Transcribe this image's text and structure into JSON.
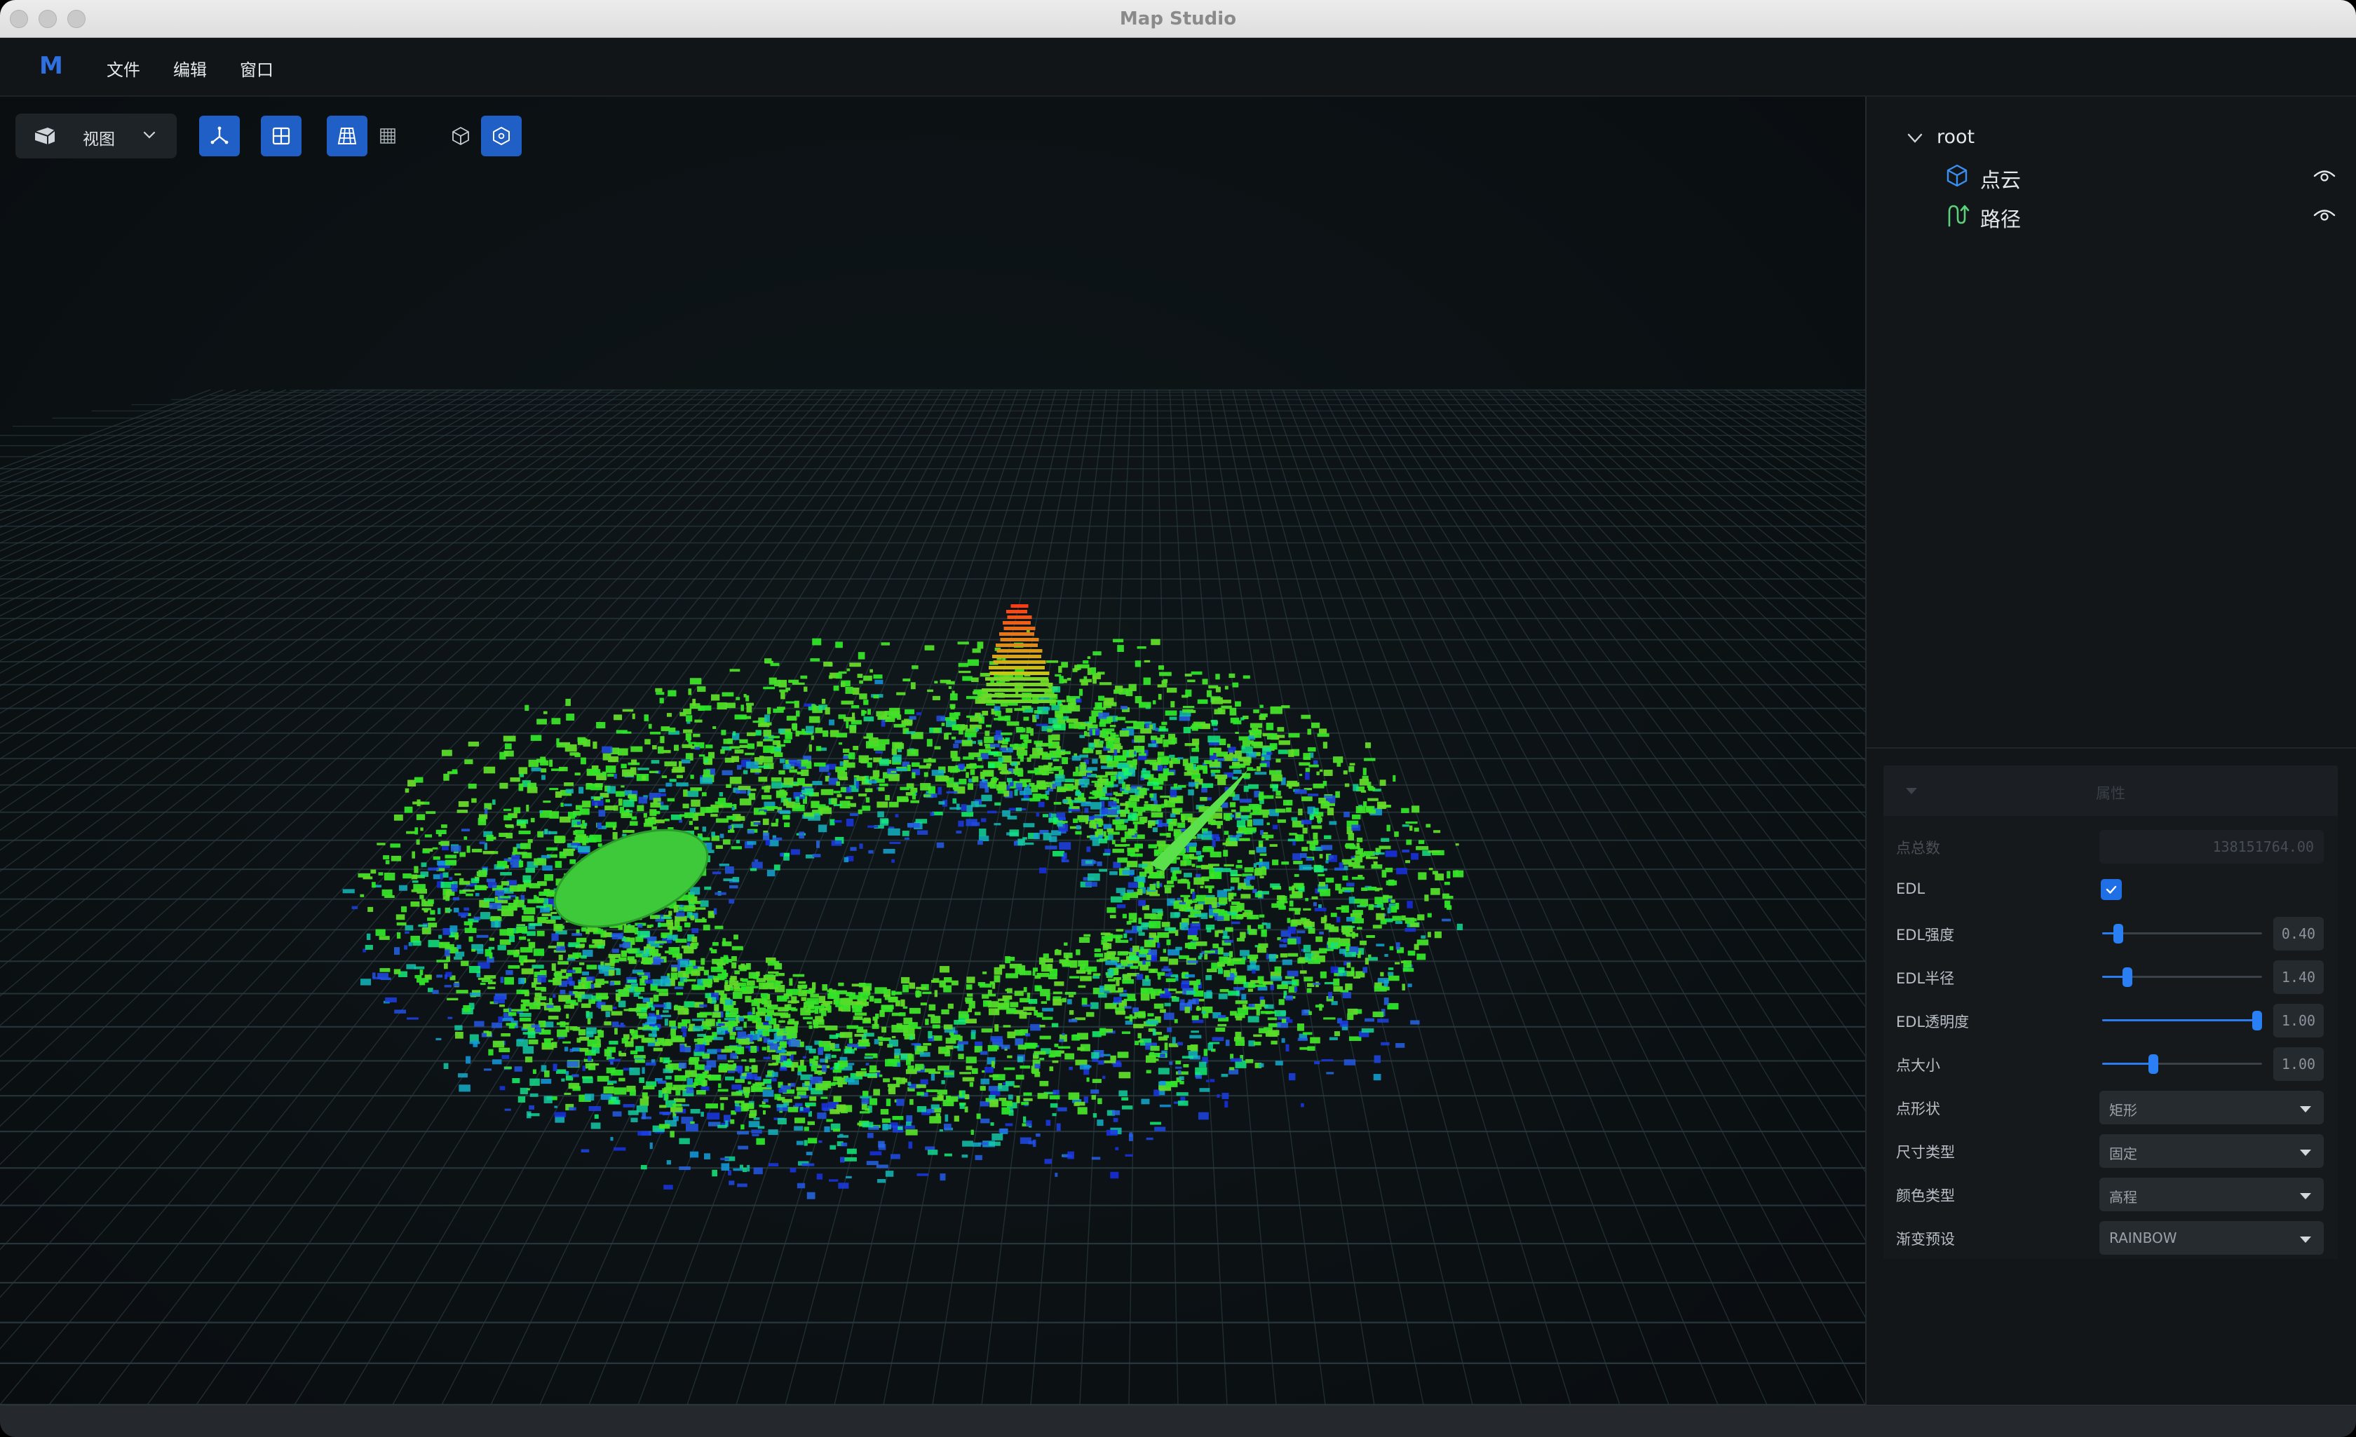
{
  "window": {
    "title": "Map Studio"
  },
  "menubar": {
    "logo": "M",
    "items": [
      {
        "label": "文件"
      },
      {
        "label": "编辑"
      },
      {
        "label": "窗口"
      }
    ]
  },
  "toolbar": {
    "view_label": "视图",
    "buttons": [
      {
        "icon": "axes-icon",
        "active": true
      },
      {
        "icon": "quad-view-icon",
        "active": true
      },
      {
        "icon": "grid-perspective-icon",
        "active": true
      },
      {
        "icon": "grid-flat-icon",
        "active": false
      },
      {
        "icon": "cube-icon",
        "active": false
      },
      {
        "icon": "hexagon-icon",
        "active": true
      }
    ]
  },
  "tree": {
    "root_label": "root",
    "items": [
      {
        "label": "点云",
        "icon": "cube-icon",
        "visible": true
      },
      {
        "label": "路径",
        "icon": "path-icon",
        "visible": true
      }
    ]
  },
  "properties": {
    "title": "属性",
    "total_points_label": "点总数",
    "total_points_value": "138151764.00",
    "edl_label": "EDL",
    "edl_checked": true,
    "sliders": [
      {
        "label": "EDL强度",
        "display": "0.40",
        "fraction": 0.1
      },
      {
        "label": "EDL半径",
        "display": "1.40",
        "fraction": 0.16
      },
      {
        "label": "EDL透明度",
        "display": "1.00",
        "fraction": 0.97
      },
      {
        "label": "点大小",
        "display": "1.00",
        "fraction": 0.32
      }
    ],
    "selects": [
      {
        "label": "点形状",
        "value": "矩形"
      },
      {
        "label": "尺寸类型",
        "value": "固定"
      },
      {
        "label": "颜色类型",
        "value": "高程"
      },
      {
        "label": "渐变预设",
        "value": "RAINBOW"
      }
    ]
  },
  "colors": {
    "accent": "#1f5fc6",
    "checkbox": "#1f6fe6",
    "path_icon": "#5ad17a",
    "cloud_icon": "#3b8ff0",
    "grid": "#2a3b40"
  }
}
